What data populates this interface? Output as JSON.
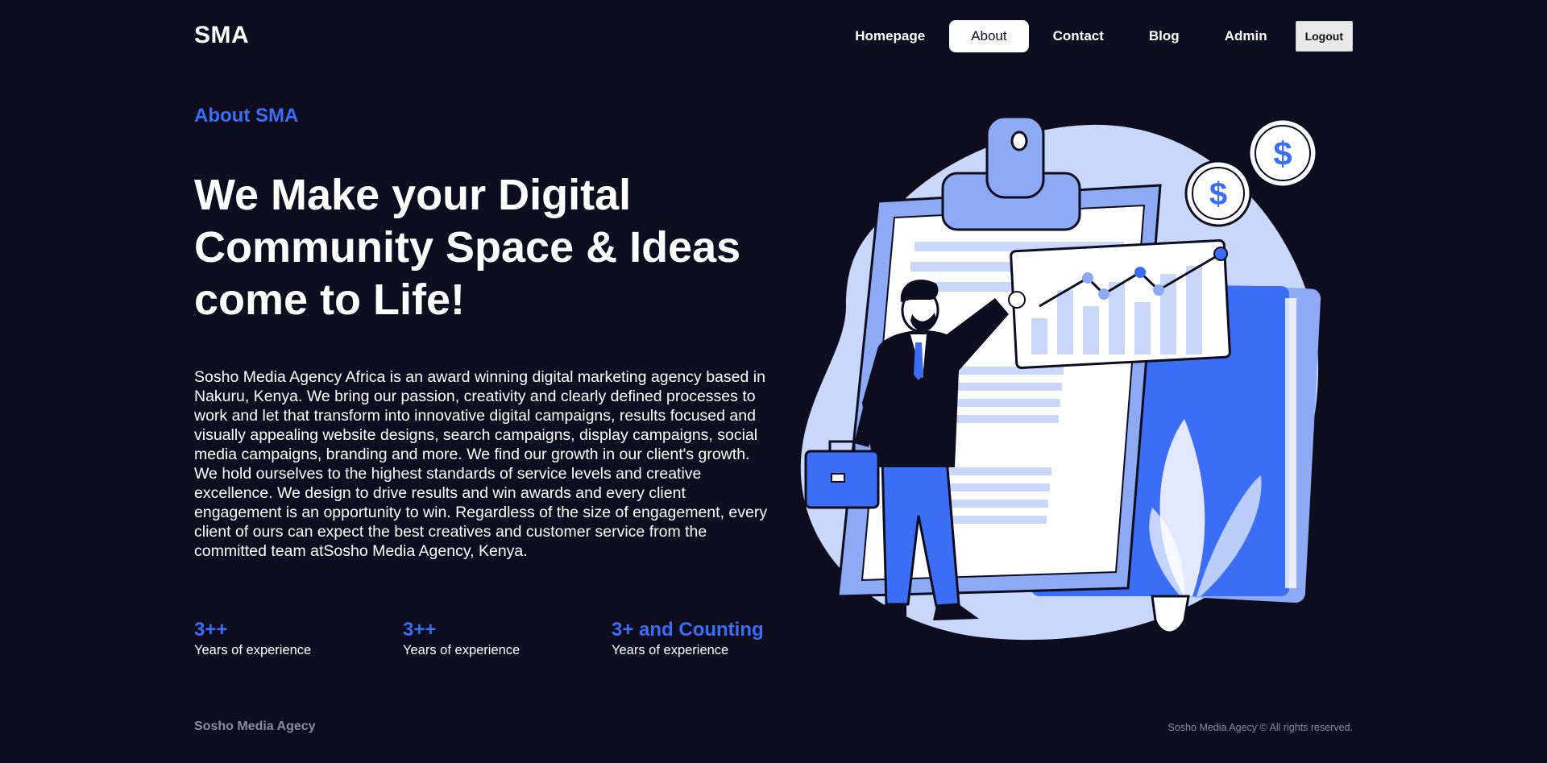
{
  "header": {
    "logo": "SMA",
    "nav": [
      {
        "label": "Homepage",
        "active": false
      },
      {
        "label": "About",
        "active": true
      },
      {
        "label": "Contact",
        "active": false
      },
      {
        "label": "Blog",
        "active": false
      },
      {
        "label": "Admin",
        "active": false
      }
    ],
    "logout_label": "Logout"
  },
  "hero": {
    "eyebrow": "About SMA",
    "headline": "We Make your Digital Community Space & Ideas come to Life!",
    "description": "Sosho Media Agency Africa is an award winning digital marketing agency based in Nakuru, Kenya. We bring our passion, creativity and clearly defined processes to work and let that transform into innovative digital campaigns, results focused and visually appealing website designs, search campaigns, display campaigns, social media campaigns, branding and more. We find our growth in our client's growth. We hold ourselves to the highest standards of service levels and creative excellence. We design to drive results and win awards and every client engagement is an opportunity to win. Regardless of the size of engagement, every client of ours can expect the best creatives and customer service from the committed team atSosho Media Agency, Kenya."
  },
  "stats": [
    {
      "value": "3++",
      "label": "Years of experience"
    },
    {
      "value": "3++",
      "label": "Years of experience"
    },
    {
      "value": "3+ and Counting",
      "label": "Years of experience"
    }
  ],
  "illustration": {
    "icon": "business-analytics-illustration",
    "currency_symbol": "$"
  },
  "footer": {
    "brand": "Sosho Media Agecy",
    "copyright": "Sosho Media Agecy © All rights reserved."
  },
  "colors": {
    "background": "#0e0d1f",
    "accent": "#3c6ef5",
    "light_blue": "#c9d7fb",
    "mid_blue": "#8eaaf5",
    "footer_text": "#8c8c99"
  }
}
